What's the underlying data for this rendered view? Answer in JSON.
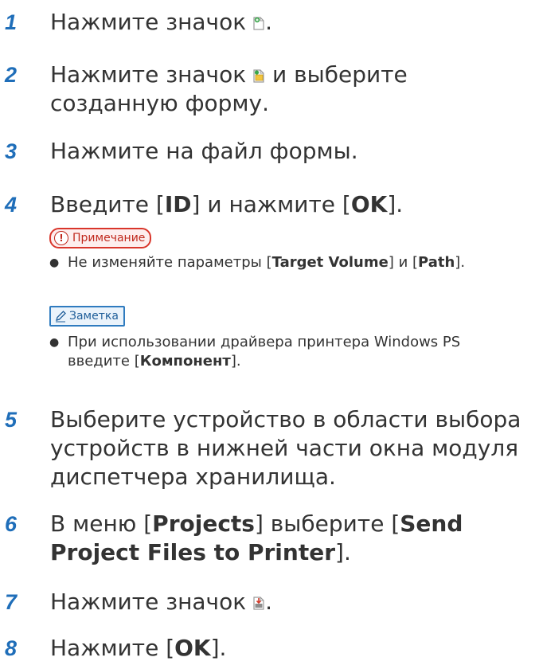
{
  "steps": [
    {
      "num": "1",
      "text_before": "Нажмите значок",
      "text_after": ".",
      "icon": "new-form-icon"
    },
    {
      "num": "2",
      "text_before": "Нажмите значок",
      "text_after": "и выберите созданную форму.",
      "icon": "open-form-icon"
    },
    {
      "num": "3",
      "text": "Нажмите на файл формы."
    },
    {
      "num": "4",
      "t1": "Введите [",
      "b1": "ID",
      "t2": "] и нажмите [",
      "b2": "OK",
      "t3": "]."
    },
    {
      "num": "5",
      "text": "Выберите устройство в области выбора устройств в нижней части окна модуля диспетчера хранилища."
    },
    {
      "num": "6",
      "t1": "В меню [",
      "b1": "Projects",
      "t2": "] выберите [",
      "b2": "Send Project Files to Printer",
      "t3": "]."
    },
    {
      "num": "7",
      "text_before": "Нажмите значок",
      "text_after": ".",
      "icon": "send-to-printer-icon"
    },
    {
      "num": "8",
      "t1": "Нажмите [",
      "b1": "OK",
      "t2": "]."
    }
  ],
  "note": {
    "label": "Примечание",
    "bang": "!",
    "bullet": {
      "t1": "Не изменяйте параметры [",
      "b1": "Target Volume",
      "t2": "] и [",
      "b2": "Path",
      "t3": "]."
    }
  },
  "memo": {
    "label": "Заметка",
    "bullet": {
      "t1": "При использовании драйвера принтера Windows PS введите [",
      "b1": "Компонент",
      "t2": "]."
    }
  },
  "colors": {
    "step_number": "#1f6eb9",
    "note_border": "#d9362b",
    "memo_border": "#2f7bbf",
    "text": "#333333"
  }
}
